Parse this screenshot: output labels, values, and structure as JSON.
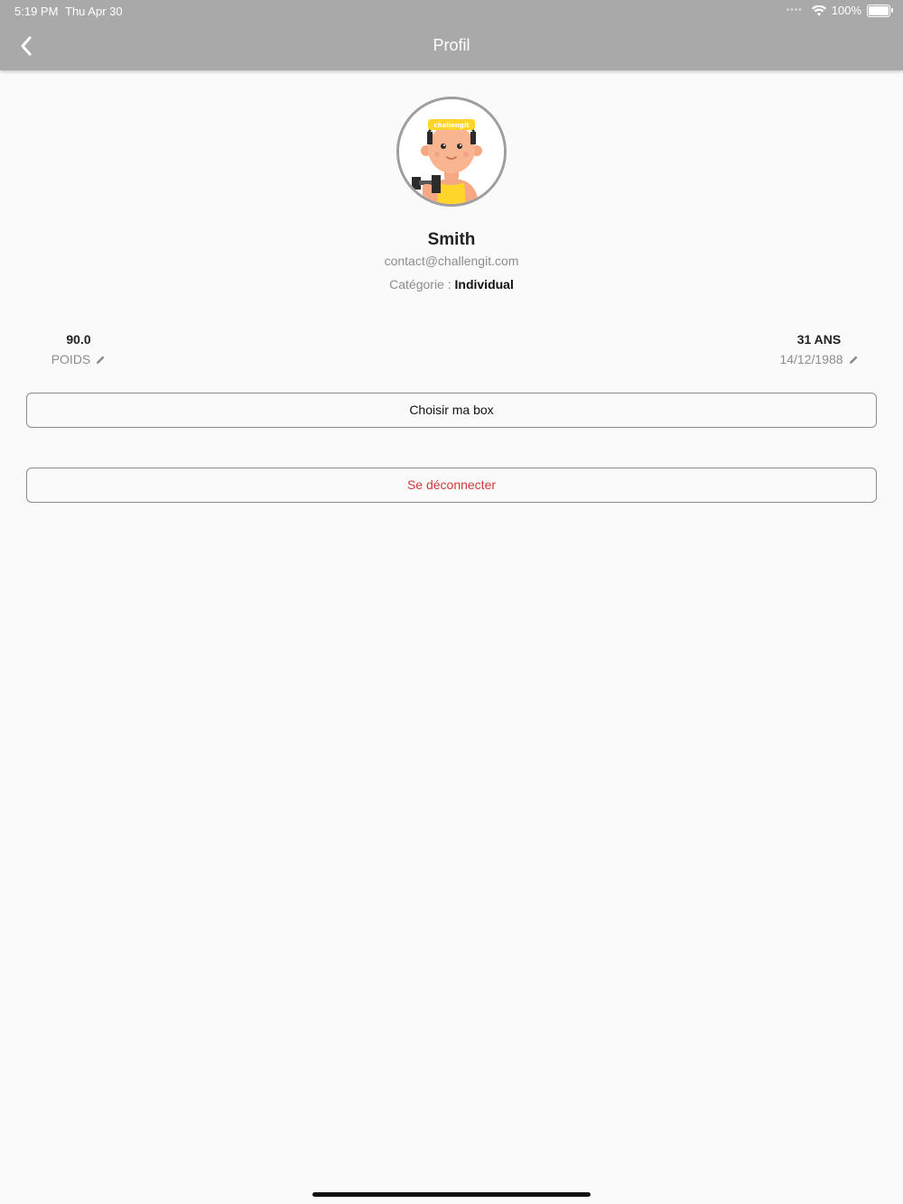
{
  "status_bar": {
    "time": "5:19 PM",
    "date": "Thu Apr 30",
    "battery_text": "100%",
    "icons": [
      "signal-icon",
      "wifi-icon",
      "battery-icon"
    ]
  },
  "nav": {
    "title": "Profil",
    "back_icon": "chevron-left-icon"
  },
  "profile": {
    "avatar_text": "challengit",
    "name": "Smith",
    "email": "contact@challengit.com",
    "category_label": "Catégorie : ",
    "category_value": "Individual"
  },
  "stats": {
    "weight": {
      "value": "90.0",
      "label": "POIDS",
      "icon": "pencil-icon"
    },
    "age": {
      "value": "31 ANS",
      "label": "14/12/1988",
      "icon": "pencil-icon"
    }
  },
  "buttons": {
    "choose_box": "Choisir ma box",
    "logout": "Se déconnecter"
  },
  "colors": {
    "header_bg": "#a9a9a9",
    "page_bg": "#fafafa",
    "logout_text": "#d23a3a",
    "avatar_border": "#9e9e9e"
  }
}
